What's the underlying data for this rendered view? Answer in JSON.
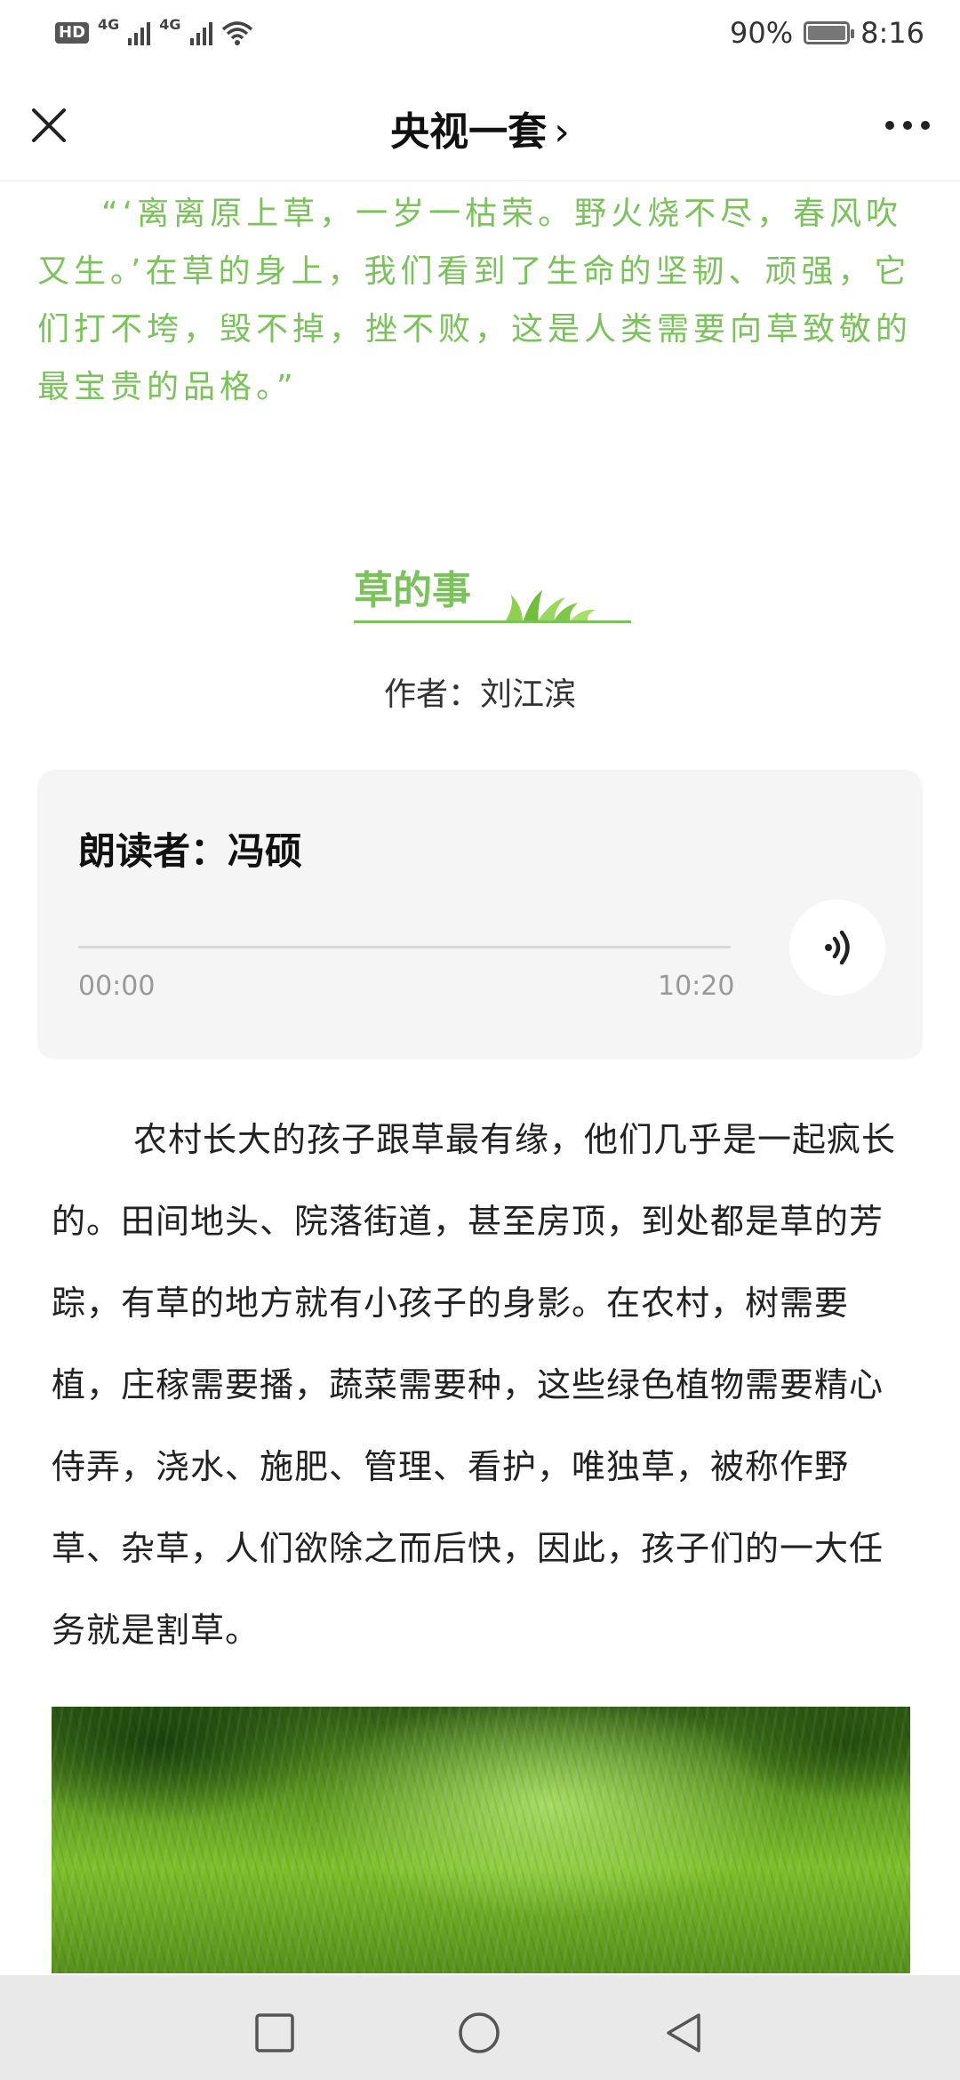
{
  "status_bar": {
    "hd_badge": "HD",
    "network_1": "4G",
    "network_2": "4G",
    "battery_percent": "90%",
    "time": "8:16"
  },
  "navbar": {
    "title": "央视一套",
    "chevron": "›"
  },
  "quote": "“‘离离原上草，一岁一枯荣。野火烧不尽，春风吹又生。’在草的身上，我们看到了生命的坚韧、顽强，它们打不垮，毁不掉，挫不败，这是人类需要向草致敬的最宝贵的品格。”",
  "article": {
    "title": "草的事",
    "author": "作者：刘江滨"
  },
  "audio": {
    "reader": "朗读者：冯硕",
    "current_time": "00:00",
    "duration": "10:20",
    "progress": 0
  },
  "body_paragraph": "农村长大的孩子跟草最有缘，他们几乎是一起疯长的。田间地头、院落街道，甚至房顶，到处都是草的芳踪，有草的地方就有小孩子的身影。在农村，树需要植，庄稼需要播，蔬菜需要种，这些绿色植物需要精心侍弄，浇水、施肥、管理、看护，唯独草，被称作野草、杂草，人们欲除之而后快，因此，孩子们的一大任务就是割草。",
  "colors": {
    "accent_green": "#7ac35a",
    "card_bg": "#f5f5f5",
    "system_nav_bg": "#e9e9e9"
  },
  "icons": {
    "close": "close-icon",
    "more": "more-icon",
    "play": "sound-wave-icon",
    "recent": "square-icon",
    "home": "circle-icon",
    "back": "triangle-back-icon"
  }
}
